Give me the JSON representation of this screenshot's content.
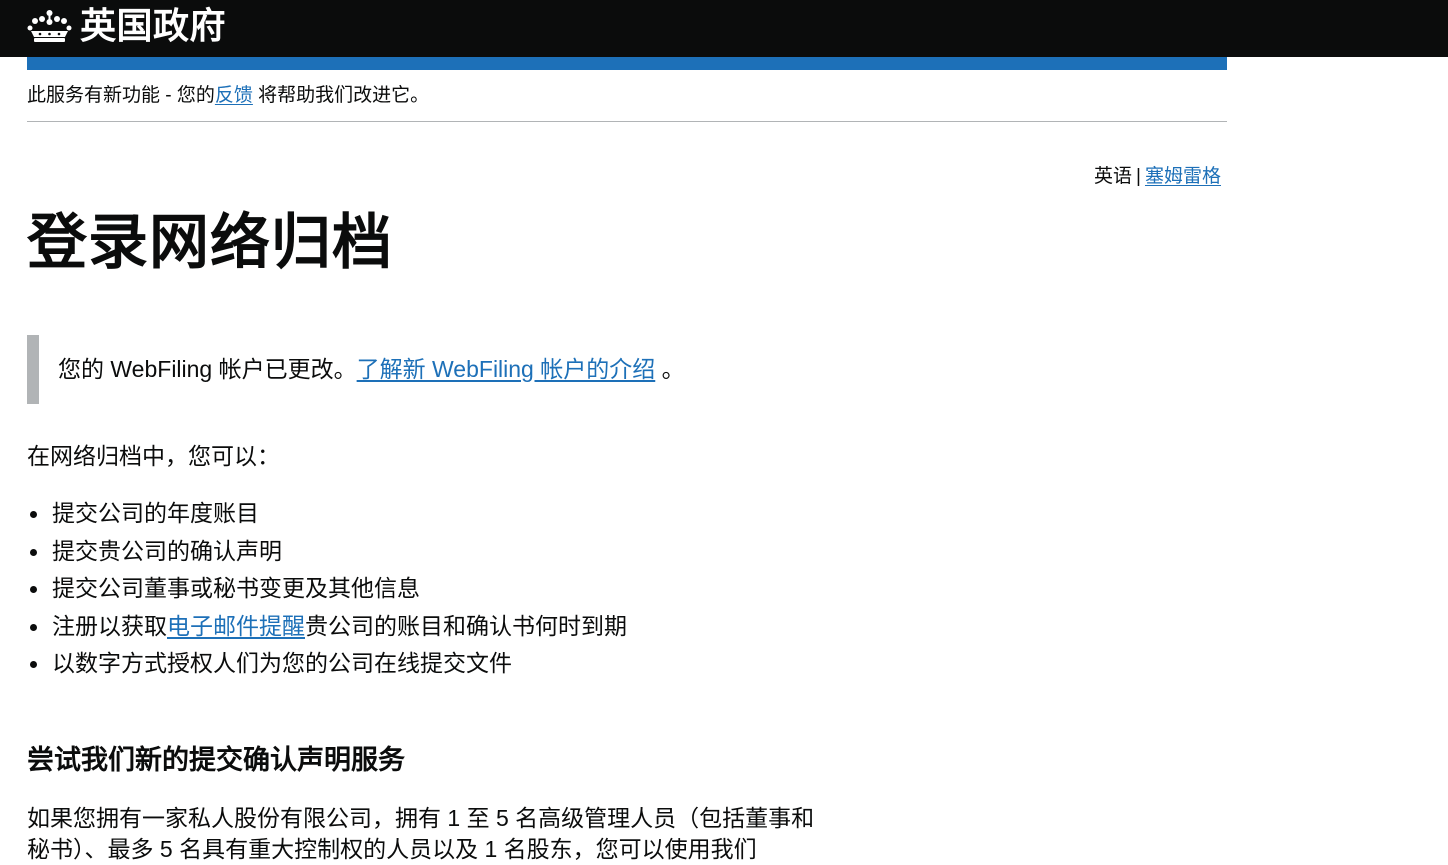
{
  "header": {
    "logo_text": "英国政府",
    "crown_icon": "crown-icon"
  },
  "phase_banner": {
    "text_before": "此服务有新功能 - 您的",
    "feedback_link": "反馈",
    "text_after": " 将帮助我们改进它。"
  },
  "language_toggle": {
    "current": "英语",
    "separator": "|",
    "other": "塞姆雷格"
  },
  "page_title": "登录网络归档",
  "inset": {
    "text": "您的 WebFiling 帐户已更改。",
    "link": "了解新 WebFiling 帐户的介绍",
    "suffix": " 。"
  },
  "intro": "在网络归档中，您可以：",
  "list": [
    {
      "text": "提交公司的年度账目"
    },
    {
      "text": "提交贵公司的确认声明"
    },
    {
      "text": "提交公司董事或秘书变更及其他信息"
    },
    {
      "before": "注册以获取",
      "link": "电子邮件提醒",
      "after": "贵公司的账目和确认书何时到期"
    },
    {
      "text": "以数字方式授权人们为您的公司在线提交文件"
    }
  ],
  "section_heading": "尝试我们新的提交确认声明服务",
  "section_para": "如果您拥有一家私人股份有限公司，拥有 1 至 5 名高级管理人员（包括董事和秘书）、最多 5 名具有重大控制权的人员以及 1 名股东，您可以使用我们",
  "colors": {
    "header_bg": "#0b0c0c",
    "accent_blue": "#1d70b8",
    "border_grey": "#b1b4b6",
    "text": "#0b0c0c"
  }
}
